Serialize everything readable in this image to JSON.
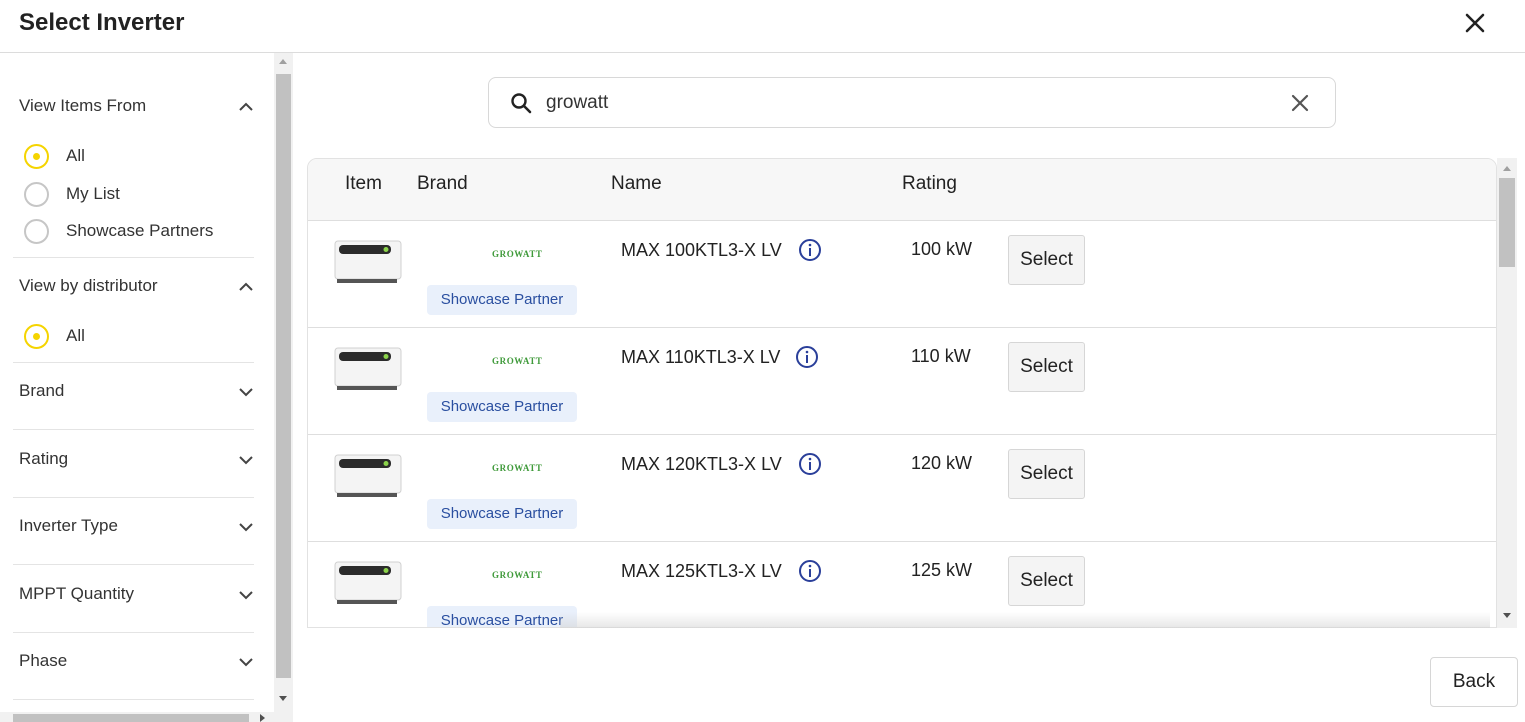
{
  "dialog": {
    "title": "Select Inverter",
    "close_icon": "close-icon"
  },
  "sidebar": {
    "view_items_from": {
      "label": "View Items From",
      "expanded": true,
      "options": [
        {
          "label": "All",
          "selected": true
        },
        {
          "label": "My List",
          "selected": false
        },
        {
          "label": "Showcase Partners",
          "selected": false
        }
      ]
    },
    "view_by_distributor": {
      "label": "View by distributor",
      "expanded": true,
      "options": [
        {
          "label": "All",
          "selected": true
        }
      ]
    },
    "filters": [
      {
        "label": "Brand",
        "expanded": false
      },
      {
        "label": "Rating",
        "expanded": false
      },
      {
        "label": "Inverter Type",
        "expanded": false
      },
      {
        "label": "MPPT Quantity",
        "expanded": false
      },
      {
        "label": "Phase",
        "expanded": false
      }
    ]
  },
  "search": {
    "value": "growatt",
    "icon": "search-icon",
    "clear_icon": "close-icon"
  },
  "table": {
    "columns": [
      "Item",
      "Brand",
      "Name",
      "Rating"
    ],
    "rows": [
      {
        "brand_logo": "GROWATT",
        "badge": "Showcase Partner",
        "name": "MAX 100KTL3-X LV",
        "rating": "100 kW",
        "action": "Select"
      },
      {
        "brand_logo": "GROWATT",
        "badge": "Showcase Partner",
        "name": "MAX 110KTL3-X LV",
        "rating": "110 kW",
        "action": "Select"
      },
      {
        "brand_logo": "GROWATT",
        "badge": "Showcase Partner",
        "name": "MAX 120KTL3-X LV",
        "rating": "120 kW",
        "action": "Select"
      },
      {
        "brand_logo": "GROWATT",
        "badge": "Showcase Partner",
        "name": "MAX 125KTL3-X LV",
        "rating": "125 kW",
        "action": "Select"
      }
    ]
  },
  "footer": {
    "back_label": "Back"
  },
  "colors": {
    "radio_selected": "#f5d400",
    "badge_bg": "#e9f0fb",
    "badge_text": "#2a4fa0",
    "info_icon": "#2a3f9a",
    "brand_logo": "#3f9a3a"
  }
}
